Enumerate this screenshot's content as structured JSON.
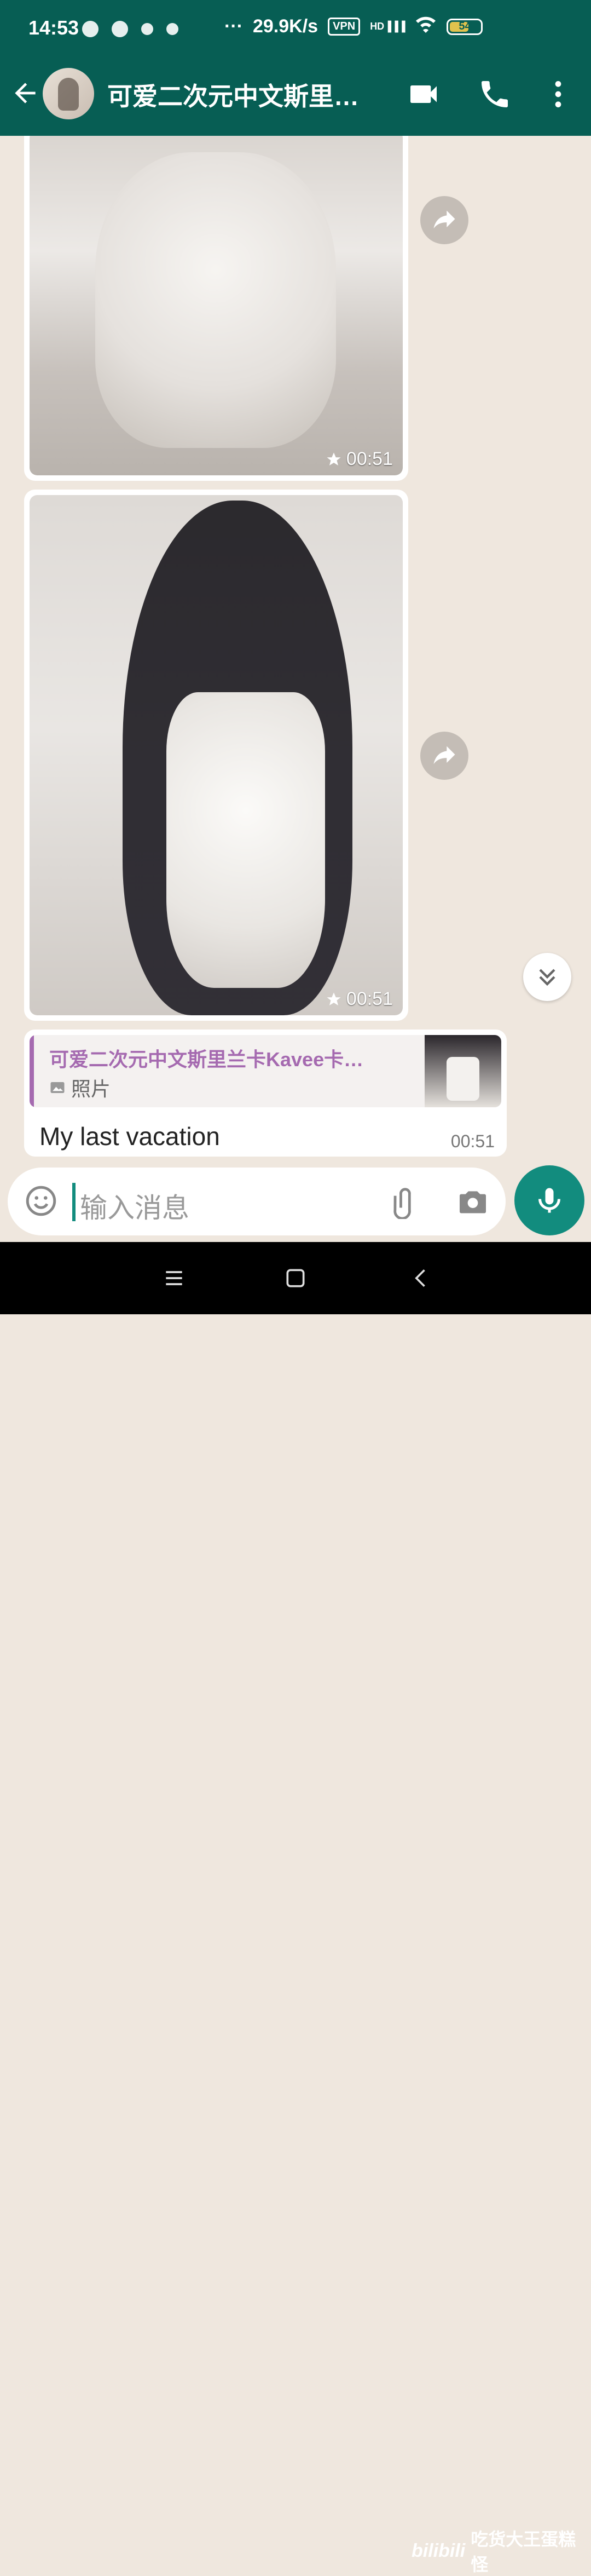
{
  "status_bar": {
    "time": "14:53",
    "speed": "29.9K/s",
    "vpn": "VPN",
    "network": "HD",
    "battery": "54"
  },
  "header": {
    "title": "可爱二次元中文斯里…"
  },
  "messages": [
    {
      "type": "photo",
      "time": "00:51",
      "starred": true
    },
    {
      "type": "photo",
      "time": "00:51",
      "starred": true
    },
    {
      "type": "reply",
      "quoted_name": "可爱二次元中文斯里兰卡Kavee卡…",
      "quoted_type": "照片",
      "text": "My last vacation",
      "time": "00:51"
    }
  ],
  "input": {
    "placeholder": "输入消息"
  },
  "watermark": {
    "logo": "bilibili",
    "text": "吃货大王蛋糕怪"
  },
  "colors": {
    "header": "#075e54",
    "accent": "#128c7e",
    "quote_name": "#a56ab0",
    "chat_bg": "#efe7de"
  }
}
